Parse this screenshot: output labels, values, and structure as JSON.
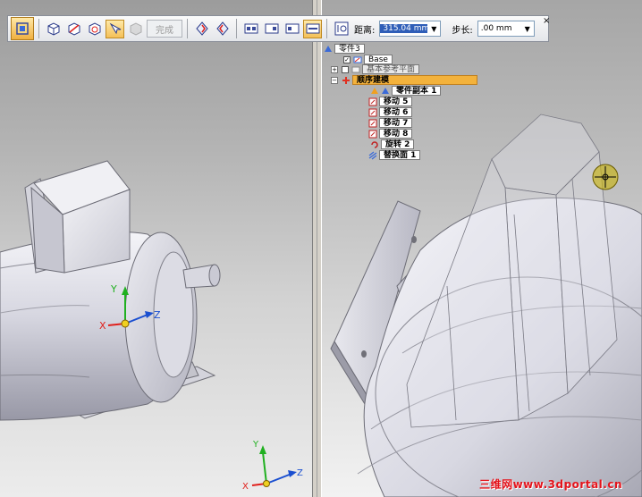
{
  "toolbar": {
    "done_label": "完成",
    "distance_label": "距离:",
    "distance_value": "315.04 mm",
    "step_label": "步长:",
    "step_value": ".00 mm",
    "close_glyph": "×"
  },
  "tree": {
    "root": "零件3",
    "base": "Base",
    "base_planes": "基本参考平面",
    "section": "顺序建模",
    "items": [
      "零件副本 1",
      "移动 5",
      "移动 6",
      "移动 7",
      "移动 8",
      "旋转 2",
      "替换面 1"
    ]
  },
  "triad": {
    "x_label": "X",
    "y_label": "Y",
    "z_label": "Z"
  },
  "colors": {
    "axis_x": "#e0201c",
    "axis_y": "#20b020",
    "axis_z": "#1a4fd0",
    "section_highlight": "#f3b23c",
    "watermark": "#e4141c"
  },
  "watermark": "三维网www.3dportal.cn"
}
